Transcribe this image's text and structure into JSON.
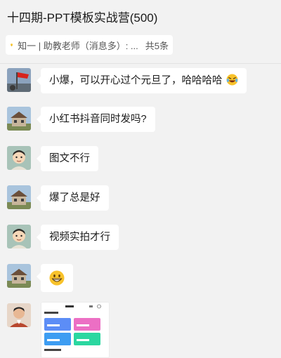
{
  "window": {
    "title": "十四期-PPT模板实战营(500)"
  },
  "pinned": {
    "text": "知一 | 助教老师（消息多）: ...",
    "count": "共5条",
    "icon": "lightbulb-icon"
  },
  "messages": [
    {
      "avatar": "flag-avatar",
      "text": "小爆，可以开心过个元旦了，哈哈哈哈",
      "emoji": "laughing-tears-emoji"
    },
    {
      "avatar": "house-avatar",
      "text": "小红书抖音同时发吗?"
    },
    {
      "avatar": "cartoon-boy-avatar",
      "text": "图文不行"
    },
    {
      "avatar": "house-avatar",
      "text": "爆了总是好"
    },
    {
      "avatar": "cartoon-boy-avatar",
      "text": "视频实拍才行"
    },
    {
      "avatar": "house-avatar",
      "emoji": "grinning-emoji"
    },
    {
      "avatar": "man-photo-avatar",
      "image": "app-screenshot-thumbnail"
    }
  ],
  "colors": {
    "background": "#f2f2f2",
    "bubble": "#ffffff"
  }
}
